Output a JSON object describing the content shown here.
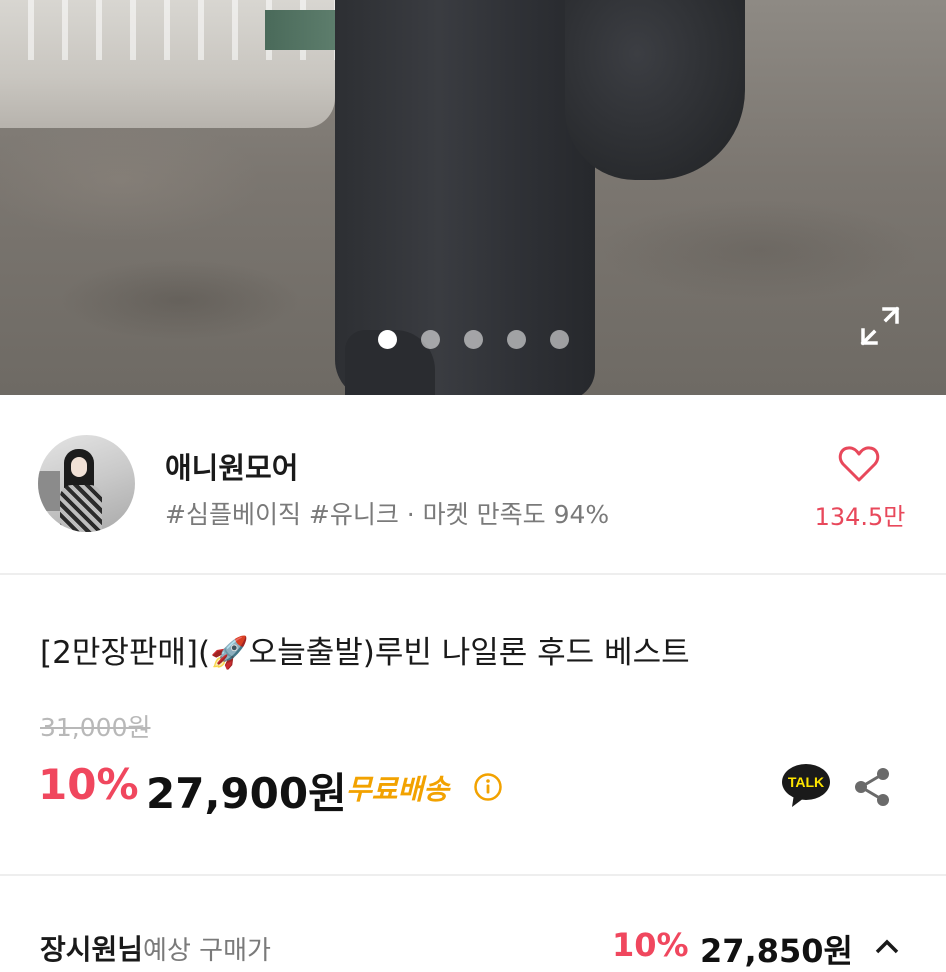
{
  "gallery": {
    "dot_count": 5,
    "active_index": 0,
    "expand_icon": "expand-icon"
  },
  "seller": {
    "name": "애니원모어",
    "tags": "#심플베이직 #유니크 · 마켓 만족도 94%",
    "like_icon": "heart-outline-icon",
    "like_count": "134.5만"
  },
  "product": {
    "title": "[2만장판매](🚀오늘출발)루빈 나일론 후드 베스트",
    "original_price": "31,000원",
    "discount": "10%",
    "price": "27,900원",
    "shipping": "무료배송",
    "info_icon": "info-circle-icon",
    "talk_badge": "TALK",
    "share_icon": "share-icon"
  },
  "bottom": {
    "label": "장시원님",
    "label_sub": "예상 구매가",
    "discount": "10%",
    "price": "27,850원"
  },
  "colors": {
    "accent": "#f0475e",
    "shipping": "#f2a200",
    "talk_bg": "#1a1a1a",
    "talk_text": "#fee500"
  }
}
